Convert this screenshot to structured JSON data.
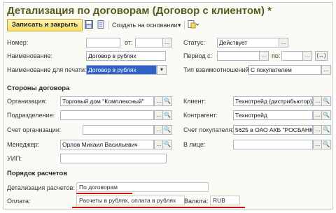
{
  "title": "Детализация по договорам (Договор с клиентом) *",
  "toolbar": {
    "save_close": "Записать и закрыть",
    "create_based": "Создать на основании",
    "create_arrow": "▾"
  },
  "fields": {
    "number_label": "Номер:",
    "from_label": "от:",
    "status_label": "Статус:",
    "status_value": "Действует",
    "name_label": "Наименование:",
    "name_value": "Договор в рублях",
    "period_label": "Период с:",
    "period_to_label": "по:",
    "print_name_label": "Наименование для печати:",
    "print_name_value": "Договор в рублях",
    "relation_label": "Тип взаимоотношений:",
    "relation_value": "С покупателем"
  },
  "parties": {
    "section_title": "Стороны договора",
    "organization_label": "Организация:",
    "organization_value": "Торговый дом \"Комплексный\"",
    "client_label": "Клиент:",
    "client_value": "Технотрейд (дистрибьютор)",
    "department_label": "Подразделение:",
    "counterparty_label": "Контрагент:",
    "counterparty_value": "Технотрейд",
    "org_account_label": "Счет организации:",
    "buyer_account_label": "Счет покупателя:",
    "buyer_account_value": "5625 в ОАО АКБ \"РОСБАНК\"",
    "manager_label": "Менеджер:",
    "manager_value": "Орлов Михаил Васильевич",
    "in_person_label": "В лице:",
    "uip_label": "УИП:"
  },
  "payment": {
    "section_title": "Порядок расчетов",
    "detail_label": "Детализация расчетов:",
    "detail_value": "По договорам",
    "payment_label": "Оплата:",
    "payment_value": "Расчеты в рублях, оплата в рублях",
    "currency_label": "Валюта:",
    "currency_value": "RUB"
  },
  "icons": {
    "ellipsis": "...",
    "search": "🔍",
    "dropdown": "▾",
    "link": "(↔)"
  },
  "colors": {
    "title": "#5a5a1e",
    "accent": "#f6dc63",
    "selection": "#2f62c6",
    "underline": "#d21010"
  }
}
